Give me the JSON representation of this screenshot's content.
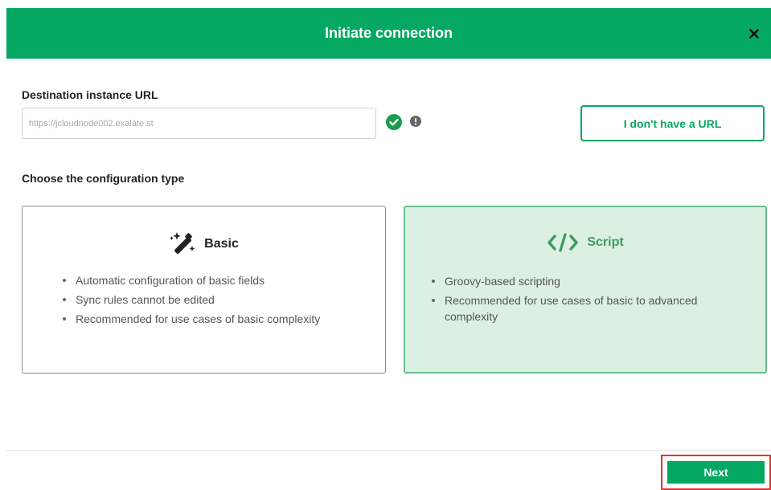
{
  "dialog": {
    "title": "Initiate connection",
    "close_icon": "close-icon"
  },
  "url_section": {
    "label": "Destination instance URL",
    "value": "https://jcloudnode002.exalate.st",
    "valid_icon": "check-circle-icon",
    "info_icon": "exclamation-circle-icon",
    "no_url_button": "I don't have a URL"
  },
  "config": {
    "label": "Choose the configuration type",
    "options": [
      {
        "title": "Basic",
        "icon": "magic-wand-icon",
        "bullets": [
          "Automatic configuration of basic fields",
          "Sync rules cannot be edited",
          "Recommended for use cases of basic complexity"
        ]
      },
      {
        "title": "Script",
        "icon": "code-icon",
        "bullets": [
          "Groovy-based scripting",
          "Recommended for use cases of basic to advanced complexity"
        ]
      }
    ],
    "selected": "Script"
  },
  "footer": {
    "next_button": "Next"
  },
  "colors": {
    "brand": "#04a863",
    "selected_card_bg": "#dcf0e2",
    "selected_card_border": "#69c08d",
    "highlight": "#e8342a"
  }
}
